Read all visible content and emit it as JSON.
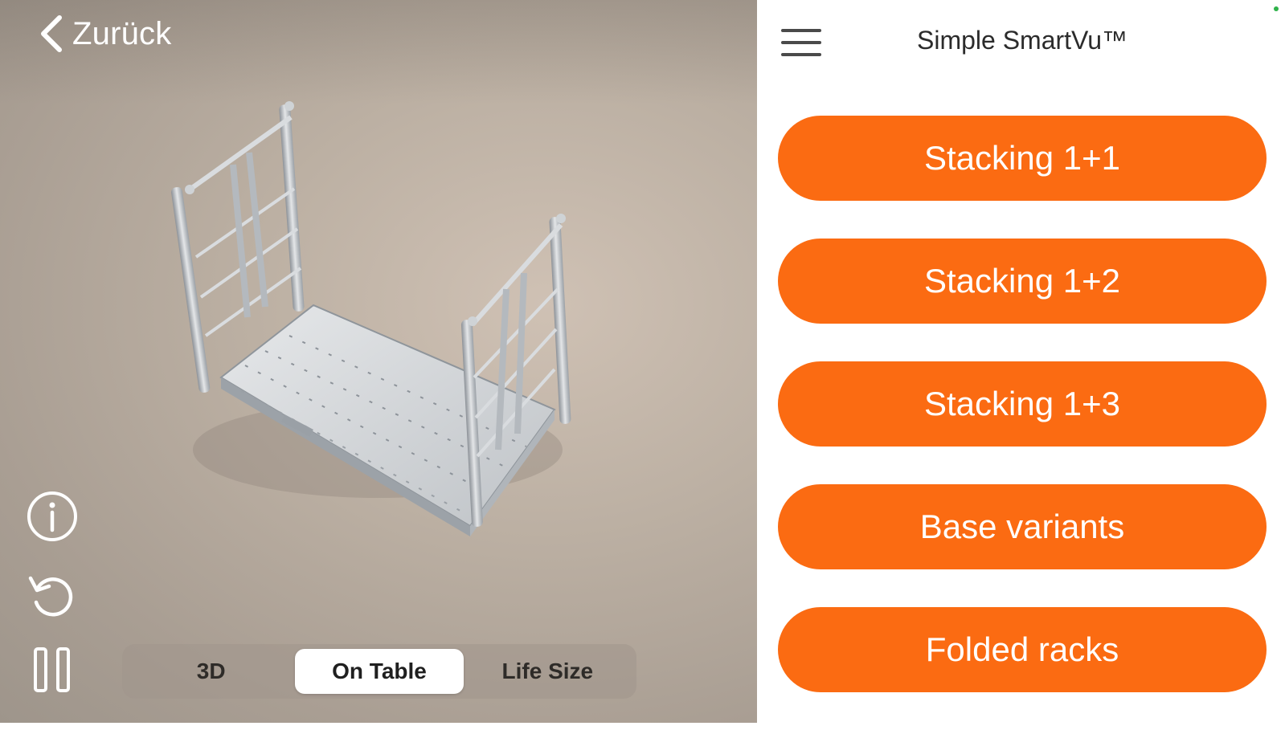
{
  "viewer": {
    "back_label": "Zurück",
    "icons": {
      "back": "chevron-left-icon",
      "info": "info-icon",
      "reset": "reset-icon",
      "pause": "pause-icon"
    },
    "modes": [
      {
        "label": "3D",
        "active": false
      },
      {
        "label": "On Table",
        "active": true
      },
      {
        "label": "Life Size",
        "active": false
      }
    ]
  },
  "panel": {
    "title": "Simple SmartVu™",
    "menu_icon": "hamburger-menu-icon",
    "accent_color": "#fb6b12",
    "buttons": [
      "Stacking 1+1",
      "Stacking 1+2",
      "Stacking 1+3",
      "Base variants",
      "Folded racks"
    ]
  }
}
